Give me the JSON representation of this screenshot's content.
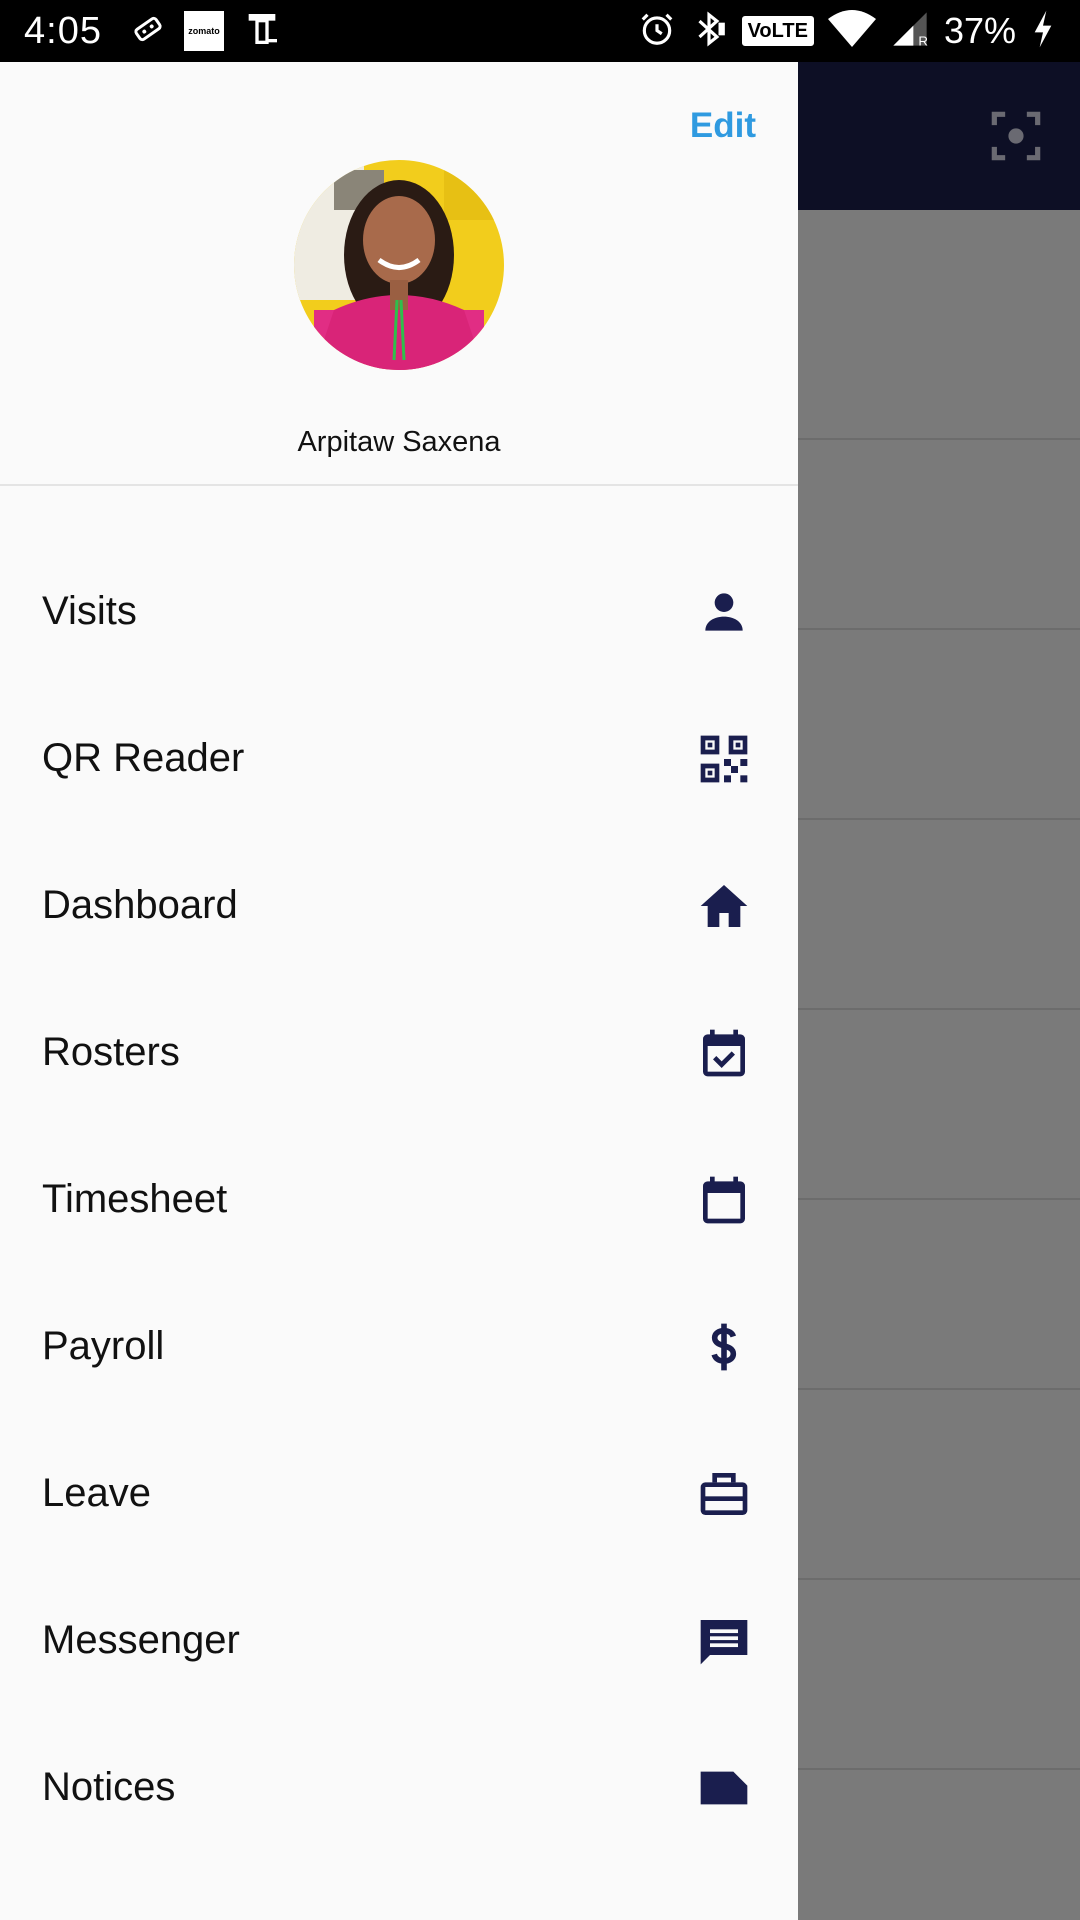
{
  "status_bar": {
    "time": "4:05",
    "left_icons": [
      "delivery-icon",
      "zomato-icon",
      "device-icon"
    ],
    "zomato_text": "zomato",
    "right_icons": [
      "alarm-icon",
      "bluetooth-icon",
      "volte-icon",
      "wifi-icon",
      "signal-icon",
      "battery-charging-icon"
    ],
    "volte_text": "VoLTE",
    "battery": "37%"
  },
  "drawer": {
    "edit_label": "Edit",
    "profile_name": "Arpitaw  Saxena",
    "menu": [
      {
        "label": "Visits",
        "icon": "person-icon"
      },
      {
        "label": "QR Reader",
        "icon": "qr-code-icon"
      },
      {
        "label": "Dashboard",
        "icon": "home-icon"
      },
      {
        "label": "Rosters",
        "icon": "calendar-check-icon"
      },
      {
        "label": "Timesheet",
        "icon": "calendar-icon"
      },
      {
        "label": "Payroll",
        "icon": "dollar-icon"
      },
      {
        "label": "Leave",
        "icon": "briefcase-icon"
      },
      {
        "label": "Messenger",
        "icon": "message-icon"
      },
      {
        "label": "Notices",
        "icon": "note-icon"
      }
    ]
  },
  "background_app": {
    "toolbar_icon": "scan-icon"
  },
  "colors": {
    "accent": "#2f9ae0",
    "icon": "#1a1e4e",
    "toolbar": "#0d0f25",
    "scrim": "#7a7a7a"
  }
}
